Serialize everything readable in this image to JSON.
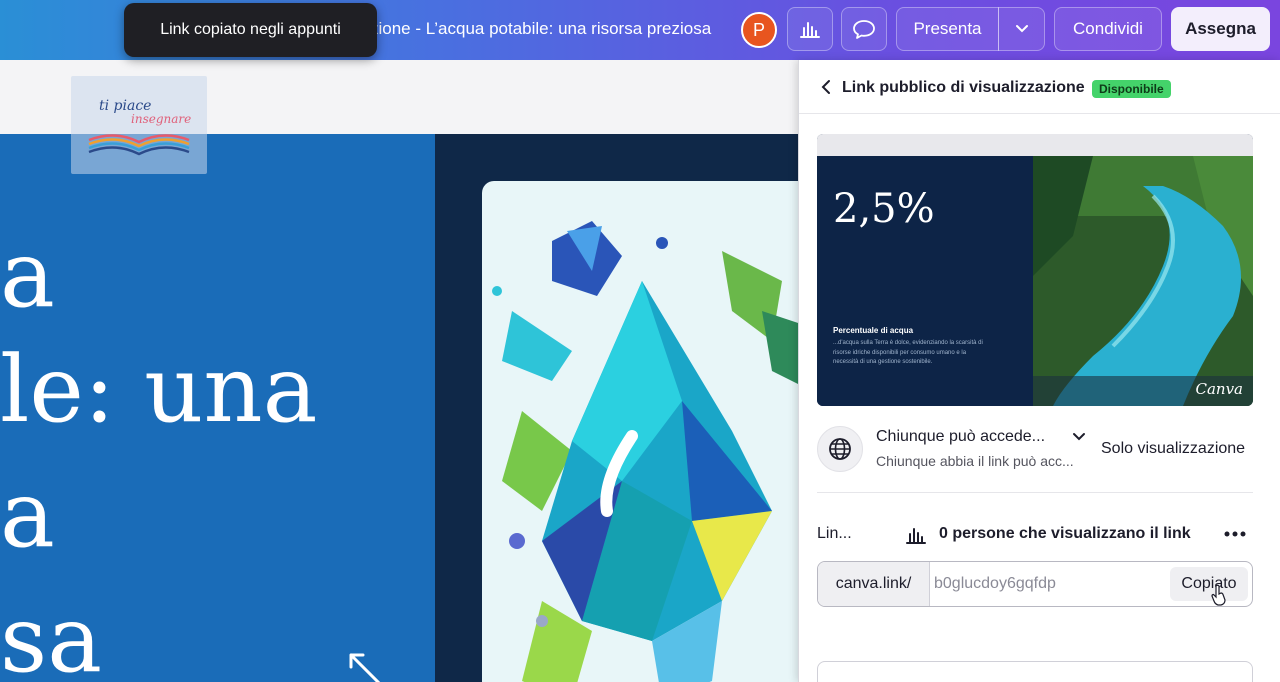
{
  "topbar": {
    "doc_title": "zione - L’acqua potabile: una risorsa preziosa",
    "avatar_initial": "P",
    "present_label": "Presenta",
    "share_label": "Condividi",
    "assign_label": "Assegna",
    "icons": [
      "bar-chart-icon",
      "comment-icon",
      "chevron-down-icon"
    ]
  },
  "toast": {
    "message": "Link copiato negli appunti"
  },
  "slide": {
    "logo_line1": "ti piace",
    "logo_line2": "insegnare",
    "text_lines": [
      "a",
      "le: una",
      "a",
      "sa"
    ]
  },
  "panel": {
    "title": "Link pubblico di visualizzazione",
    "badge": "Disponibile",
    "preview": {
      "percent": "2,5%",
      "subtitle": "Percentuale di acqua",
      "description": "...d'acqua sulla Terra è dolce, evidenziando la scarsità di risorse idriche disponibili per consumo umano e la necessità di una gestione sostenibile.",
      "brand": "Canva"
    },
    "access": {
      "who": "Chiunque può accede...",
      "who_detail": "Chiunque abbia il link può acc...",
      "role": "Solo visualizzazione"
    },
    "link_section": {
      "label": "Lin...",
      "viewers": "0 persone che visualizzano il link",
      "prefix": "canva.link/",
      "slug": "b0glucdoy6gqfdp",
      "copy_label": "Copiato"
    },
    "colors": {
      "badge": "#44d36a",
      "accent": "#7a45df"
    }
  }
}
